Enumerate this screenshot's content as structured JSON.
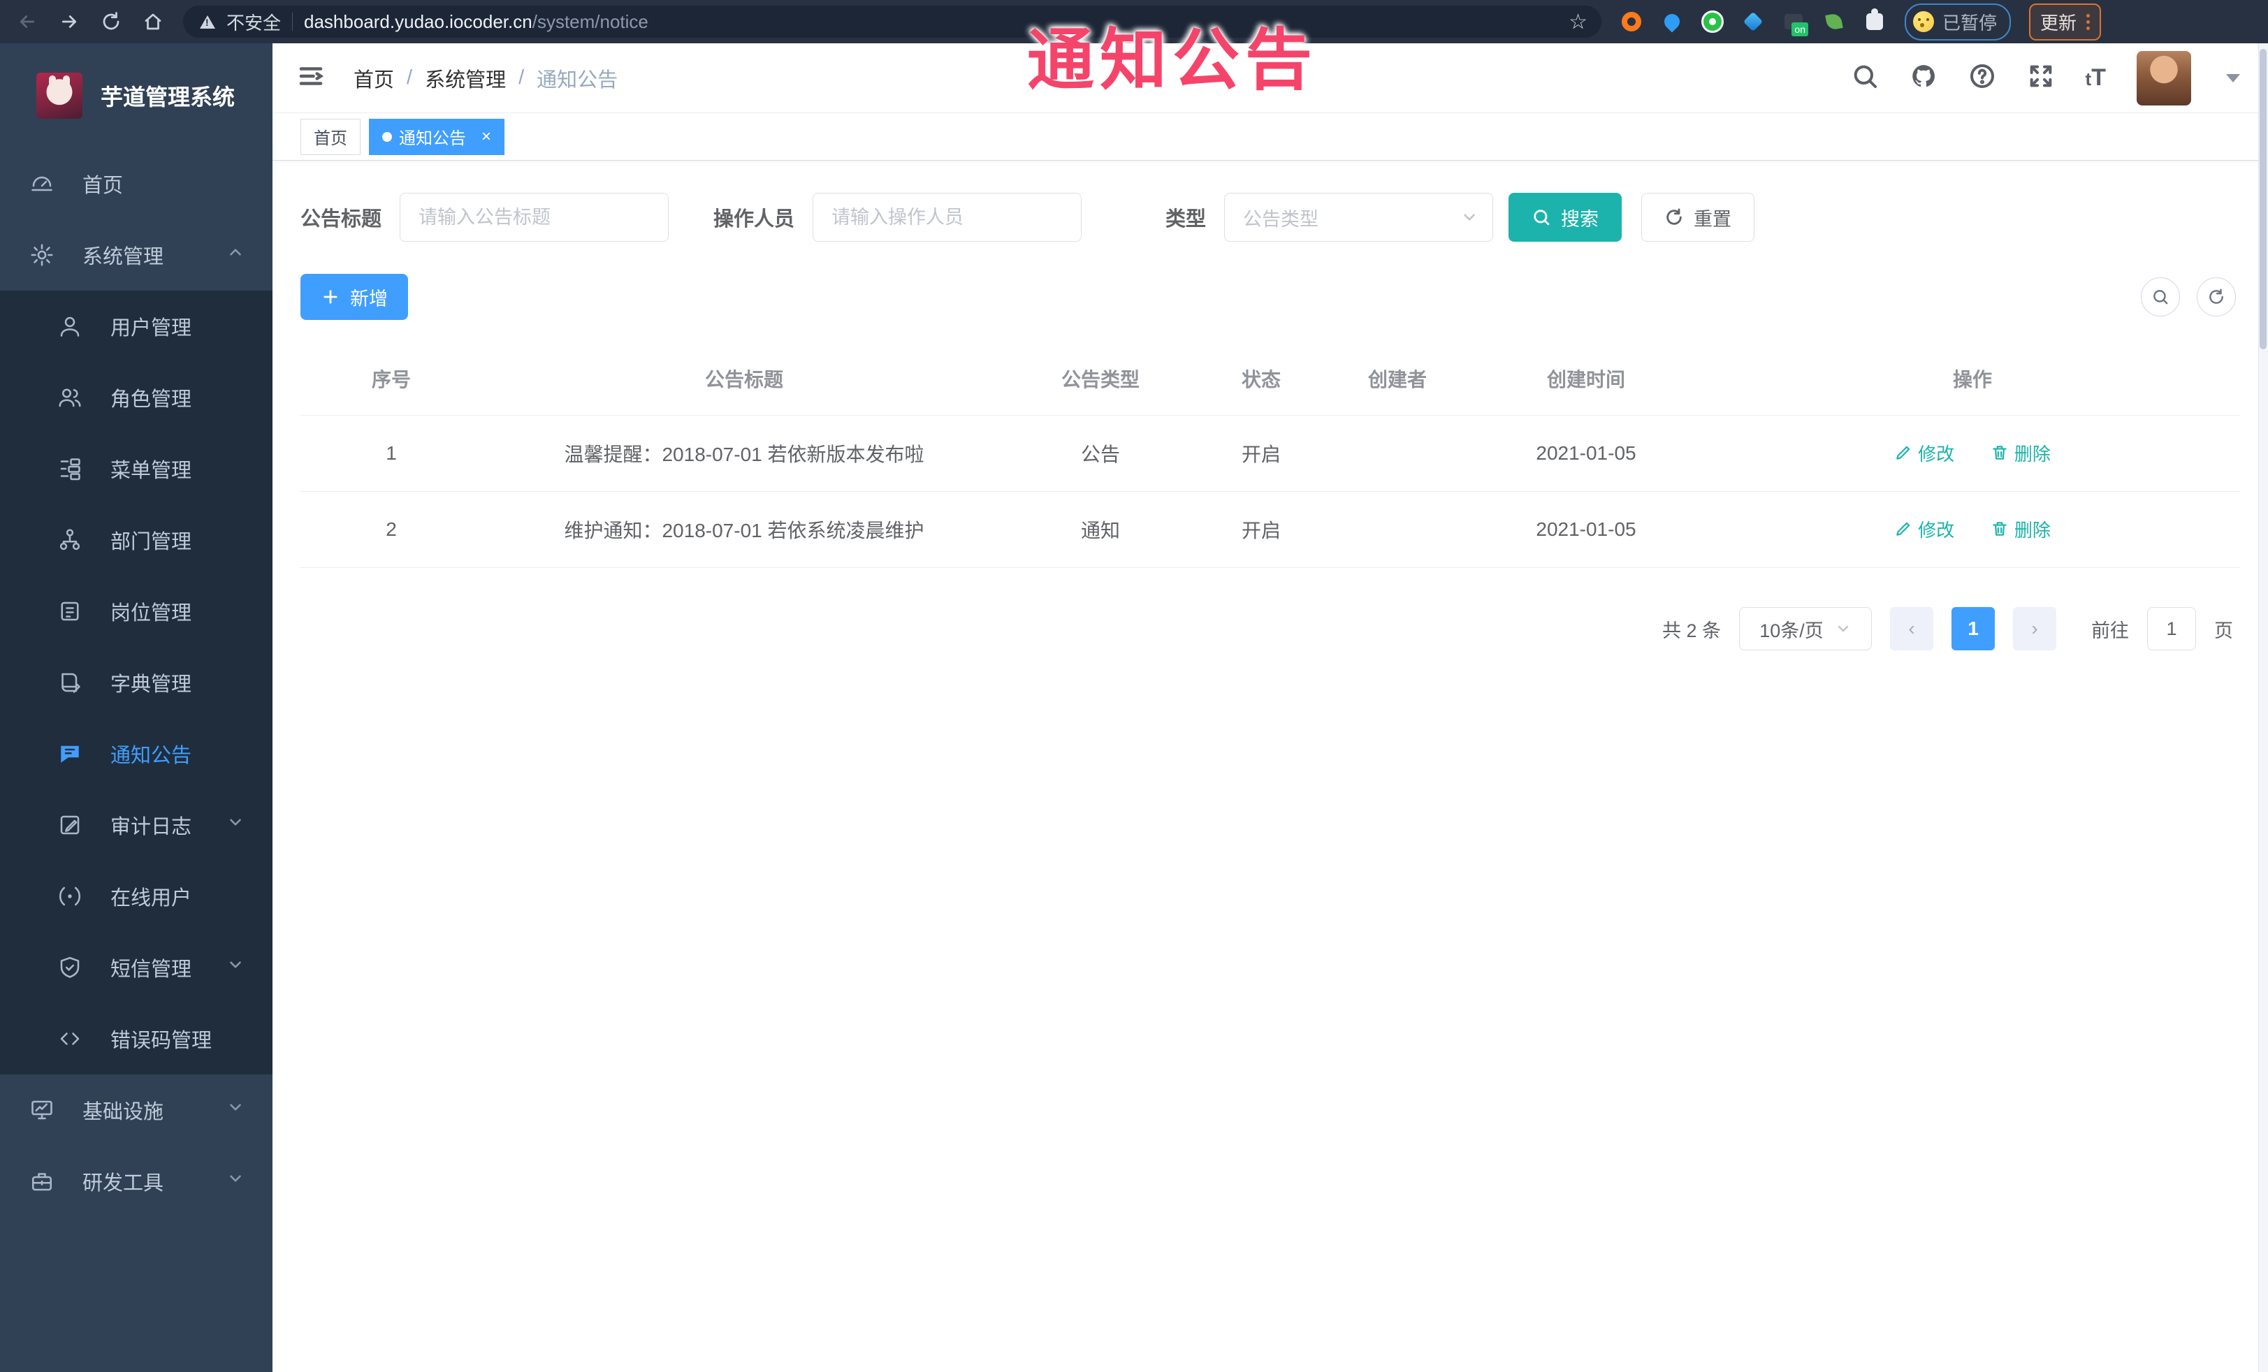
{
  "browser": {
    "security_label": "不安全",
    "url_host": "dashboard.yudao.iocoder.cn",
    "url_path": "/system/notice",
    "paused_label": "已暂停",
    "update_label": "更新"
  },
  "overlay": {
    "text": "通知公告"
  },
  "colors": {
    "accent_blue": "#409eff",
    "teal_action": "#1bb3ab",
    "sidebar_bg": "#304156",
    "submenu_bg": "#1f2d3d",
    "overlay_red": "#f5446a"
  },
  "sidebar": {
    "logo_title": "芋道管理系统",
    "items": [
      {
        "label": "首页",
        "icon": "dashboard-icon"
      },
      {
        "label": "系统管理",
        "icon": "gear-icon",
        "arrow": "up"
      },
      {
        "label": "用户管理",
        "icon": "user-icon"
      },
      {
        "label": "角色管理",
        "icon": "users-icon"
      },
      {
        "label": "菜单管理",
        "icon": "menu-tree-icon"
      },
      {
        "label": "部门管理",
        "icon": "org-icon"
      },
      {
        "label": "岗位管理",
        "icon": "badge-icon"
      },
      {
        "label": "字典管理",
        "icon": "book-icon"
      },
      {
        "label": "通知公告",
        "icon": "message-icon",
        "active": true
      },
      {
        "label": "审计日志",
        "icon": "log-icon",
        "arrow": "down"
      },
      {
        "label": "在线用户",
        "icon": "online-icon"
      },
      {
        "label": "短信管理",
        "icon": "shield-icon",
        "arrow": "down"
      },
      {
        "label": "错误码管理",
        "icon": "code-icon"
      },
      {
        "label": "基础设施",
        "icon": "monitor-icon",
        "arrow": "down"
      },
      {
        "label": "研发工具",
        "icon": "tools-icon",
        "arrow": "down"
      }
    ]
  },
  "header": {
    "breadcrumb": [
      "首页",
      "系统管理",
      "通知公告"
    ],
    "separator": "/"
  },
  "tabs": [
    {
      "label": "首页"
    },
    {
      "label": "通知公告",
      "close": "×",
      "active": true
    }
  ],
  "filters": {
    "title_label": "公告标题",
    "title_placeholder": "请输入公告标题",
    "operator_label": "操作人员",
    "operator_placeholder": "请输入操作人员",
    "type_label": "类型",
    "type_placeholder": "公告类型",
    "search_label": "搜索",
    "reset_label": "重置"
  },
  "toolbar": {
    "add_label": "新增"
  },
  "table": {
    "columns": [
      "序号",
      "公告标题",
      "公告类型",
      "状态",
      "创建者",
      "创建时间",
      "操作"
    ],
    "rows": [
      {
        "no": "1",
        "title": "温馨提醒：2018-07-01 若依新版本发布啦",
        "type": "公告",
        "status": "开启",
        "creator": "",
        "created": "2021-01-05"
      },
      {
        "no": "2",
        "title": "维护通知：2018-07-01 若依系统凌晨维护",
        "type": "通知",
        "status": "开启",
        "creator": "",
        "created": "2021-01-05"
      }
    ],
    "edit_label": "修改",
    "delete_label": "删除"
  },
  "pagination": {
    "total_text": "共 2 条",
    "page_size": "10条/页",
    "prev": "‹",
    "current_page": "1",
    "next": "›",
    "goto_label": "前往",
    "goto_value": "1",
    "page_label": "页"
  }
}
